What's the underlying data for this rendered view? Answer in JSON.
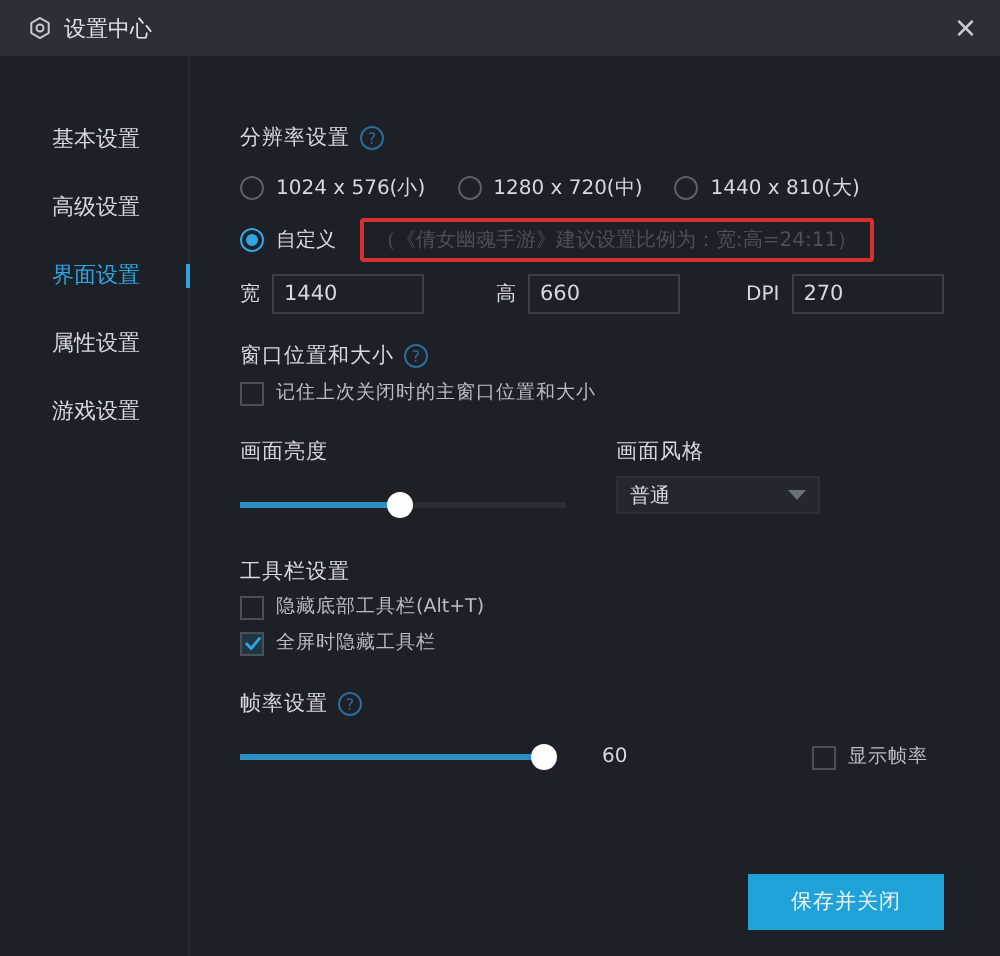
{
  "window": {
    "title": "设置中心",
    "close": "×"
  },
  "sidebar": {
    "items": [
      {
        "label": "基本设置",
        "selected": false
      },
      {
        "label": "高级设置",
        "selected": false
      },
      {
        "label": "界面设置",
        "selected": true
      },
      {
        "label": "属性设置",
        "selected": false
      },
      {
        "label": "游戏设置",
        "selected": false
      }
    ]
  },
  "resolution": {
    "title": "分辨率设置",
    "help": "?",
    "options": [
      {
        "label": "1024 x 576(小)",
        "selected": false
      },
      {
        "label": "1280 x 720(中)",
        "selected": false
      },
      {
        "label": "1440 x 810(大)",
        "selected": false
      },
      {
        "label": "自定义",
        "selected": true
      }
    ],
    "hint": "（《倩女幽魂手游》建议设置比例为：宽:高=24:11）",
    "fields": [
      {
        "label": "宽",
        "value": "1440"
      },
      {
        "label": "高",
        "value": "660"
      },
      {
        "label": "DPI",
        "value": "270"
      }
    ]
  },
  "window_position": {
    "title": "窗口位置和大小",
    "help": "?",
    "checkbox": {
      "label": "记住上次关闭时的主窗口位置和大小",
      "checked": false
    }
  },
  "brightness": {
    "title": "画面亮度",
    "level": 0.51
  },
  "style": {
    "title": "画面风格",
    "value": "普通"
  },
  "toolbar": {
    "title": "工具栏设置",
    "checkboxes": [
      {
        "label": "隐藏底部工具栏(Alt+T)",
        "checked": false
      },
      {
        "label": "全屏时隐藏工具栏",
        "checked": true
      }
    ]
  },
  "framerate": {
    "title": "帧率设置",
    "help": "?",
    "level": 1.0,
    "reading": "60",
    "checkbox": {
      "label": "显示帧率",
      "checked": false
    }
  },
  "buttons": [
    "保存并关闭"
  ]
}
